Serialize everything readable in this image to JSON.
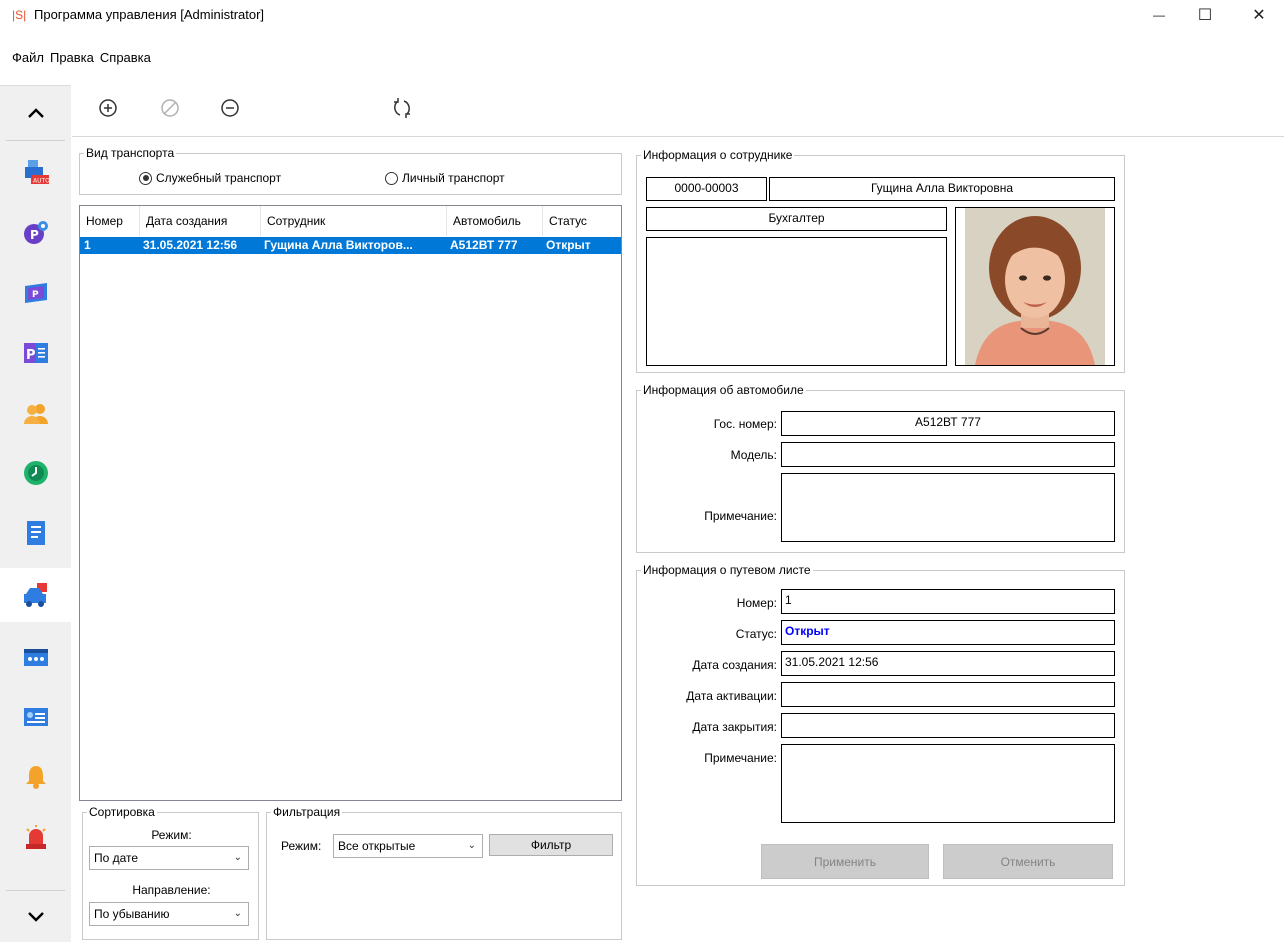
{
  "window": {
    "logo": "|S|",
    "title": "Программа управления [Administrator]",
    "minimize": "—",
    "maximize": "☐",
    "close": "✕"
  },
  "menu": [
    "Файл",
    "Правка",
    "Справка"
  ],
  "sidebar": {
    "up": "^",
    "down": "v",
    "items": [
      {
        "icon": "auto-printer-icon"
      },
      {
        "icon": "parking-settings-icon"
      },
      {
        "icon": "parking-ticket-icon"
      },
      {
        "icon": "parking-list-icon"
      },
      {
        "icon": "users-icon"
      },
      {
        "icon": "clock-icon"
      },
      {
        "icon": "document-icon"
      },
      {
        "icon": "vehicle-icon"
      },
      {
        "icon": "gate-icon"
      },
      {
        "icon": "id-card-icon"
      },
      {
        "icon": "bell-icon"
      },
      {
        "icon": "alarm-light-icon"
      }
    ],
    "active_index": 7
  },
  "toolbar": {
    "add_icon": "plus-circle-icon",
    "disable_icon": "forbidden-icon",
    "remove_icon": "minus-circle-icon",
    "refresh_icon": "refresh-icon"
  },
  "transport_type": {
    "title": "Вид транспорта",
    "option_service": "Служебный транспорт",
    "option_personal": "Личный транспорт",
    "selected": "Служебный транспорт"
  },
  "table": {
    "columns": [
      "Номер",
      "Дата создания",
      "Сотрудник",
      "Автомобиль",
      "Статус"
    ],
    "rows": [
      [
        "1",
        "31.05.2021 12:56",
        "Гущина Алла Викторов...",
        "А512ВТ 777",
        "Открыт"
      ]
    ]
  },
  "sorting": {
    "title": "Сортировка",
    "mode_label": "Режим:",
    "mode_value": "По дате",
    "direction_label": "Направление:",
    "direction_value": "По убыванию"
  },
  "filter": {
    "title": "Фильтрация",
    "mode_label": "Режим:",
    "mode_value": "Все открытые",
    "button": "Фильтр"
  },
  "employee": {
    "title": "Информация о сотруднике",
    "id": "0000-00003",
    "name": "Гущина Алла Викторовна",
    "position": "Бухгалтер",
    "notes": ""
  },
  "car": {
    "title": "Информация об автомобиле",
    "plate_label": "Гос. номер:",
    "plate": "А512ВТ 777",
    "model_label": "Модель:",
    "model": "",
    "note_label": "Примечание:",
    "note": ""
  },
  "waybill": {
    "title": "Информация о путевом листе",
    "number_label": "Номер:",
    "number": "1",
    "status_label": "Статус:",
    "status": "Открыт",
    "created_label": "Дата создания:",
    "created": "31.05.2021 12:56",
    "activated_label": "Дата активации:",
    "activated": "",
    "closed_label": "Дата закрытия:",
    "closed": "",
    "note_label": "Примечание:",
    "note": "",
    "apply_button": "Применить",
    "cancel_button": "Отменить"
  },
  "colors": {
    "selection": "#0078d7",
    "status_open": "#0000ff",
    "sidebar_bg": "#f0f0f0"
  }
}
